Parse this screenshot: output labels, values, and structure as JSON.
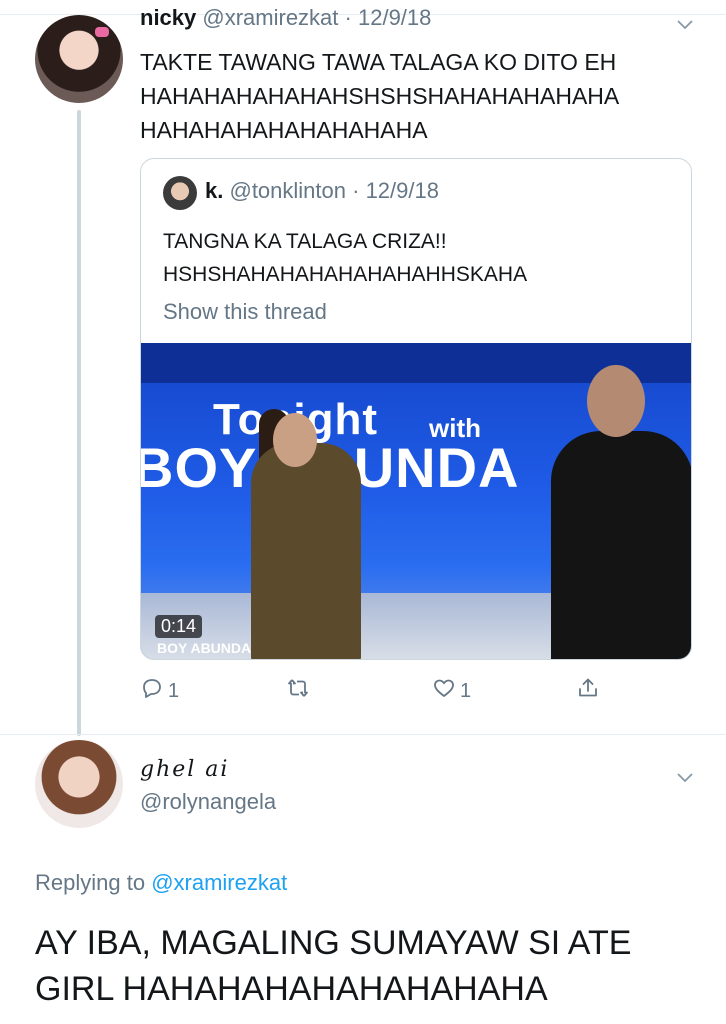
{
  "tweet": {
    "name": "nicky",
    "handle": "@xramirezkat",
    "date": "· 12/9/18",
    "lines": [
      "TAKTE TAWANG TAWA TALAGA KO DITO EH",
      "HAHAHAHAHAHAHSHSHSHAHAHAHAHAHA",
      "HAHAHAHAHAHAHAHAHA"
    ]
  },
  "quoted": {
    "name": "k.",
    "handle": "@tonklinton",
    "date": "· 12/9/18",
    "lines": [
      "TANGNA KA TALAGA CRIZA!!",
      "HSHSHAHAHAHAHAHAHAHHSKAHA"
    ],
    "show_thread": "Show this thread",
    "video": {
      "title_top": "Tonight",
      "title_with": "with",
      "title_bottom": "BOY ABUNDA",
      "duration": "0:14",
      "watermark": "BOY ABUNDA"
    }
  },
  "actions": {
    "reply_count": "1",
    "retweet_count": "",
    "like_count": "1"
  },
  "reply": {
    "name": "ghel ai",
    "handle": "@rolynangela",
    "replying_prefix": "Replying to",
    "replying_to": "@xramirezkat",
    "text": "AY IBA, MAGALING SUMAYAW SI ATE GIRL HAHAHAHAHAHAHAHAHA"
  },
  "icons": {
    "reply": "reply-icon",
    "retweet": "retweet-icon",
    "like": "heart-icon",
    "share": "share-icon",
    "more": "chevron-down-icon"
  },
  "colors": {
    "link": "#1da1f2",
    "secondary": "#657786",
    "text": "#14171a"
  }
}
